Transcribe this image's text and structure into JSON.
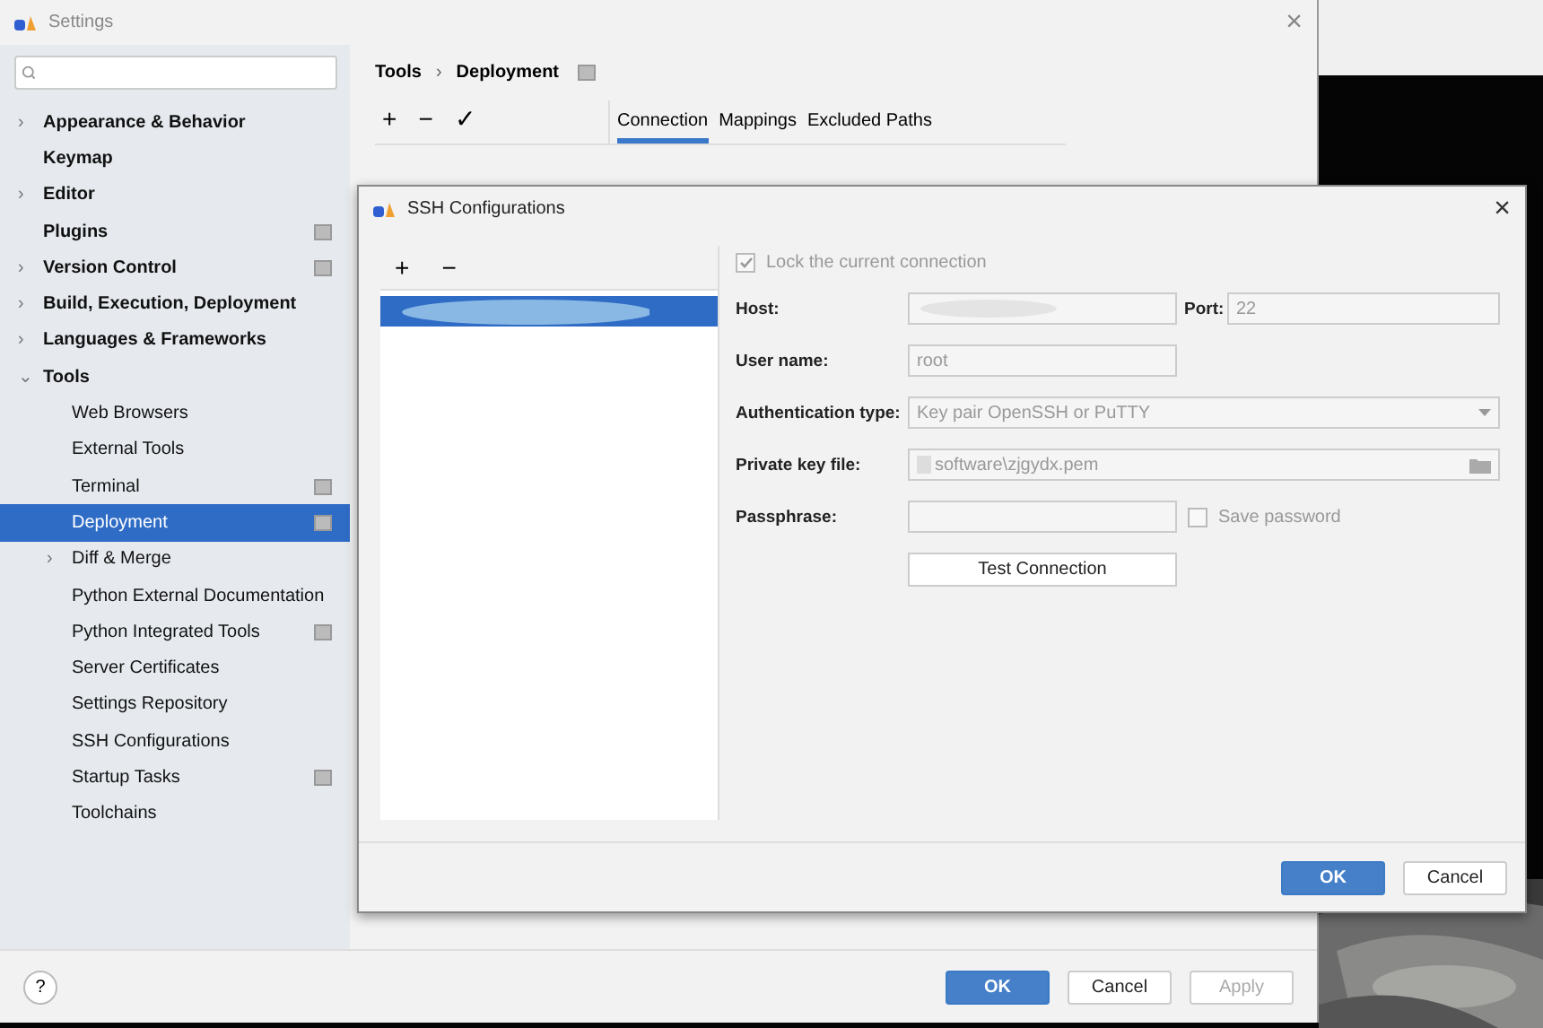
{
  "window": {
    "title": "Settings",
    "close": "×"
  },
  "sidebar": {
    "items": [
      {
        "label": "Appearance & Behavior",
        "toggle": "›",
        "badge": false,
        "selected": false
      },
      {
        "label": "Keymap",
        "badge": false,
        "selected": false
      },
      {
        "label": "Editor",
        "toggle": "›",
        "badge": false,
        "selected": false
      },
      {
        "label": "Plugins",
        "badge": true,
        "selected": false
      },
      {
        "label": "Version Control",
        "toggle": "›",
        "badge": true,
        "selected": false
      },
      {
        "label": "Build, Execution, Deployment",
        "toggle": "›",
        "badge": false,
        "selected": false
      },
      {
        "label": "Languages & Frameworks",
        "toggle": "›",
        "badge": false,
        "selected": false
      },
      {
        "label": "Tools",
        "toggle": "⌄",
        "badge": false,
        "selected": false,
        "children": [
          {
            "label": "Web Browsers",
            "badge": false,
            "selected": false
          },
          {
            "label": "External Tools",
            "badge": false,
            "selected": false
          },
          {
            "label": "Terminal",
            "badge": true,
            "selected": false
          },
          {
            "label": "Deployment",
            "badge": true,
            "selected": true
          },
          {
            "label": "Diff & Merge",
            "toggle": "›",
            "badge": false,
            "selected": false
          },
          {
            "label": "Python External Documentation",
            "badge": false,
            "selected": false
          },
          {
            "label": "Python Integrated Tools",
            "badge": true,
            "selected": false
          },
          {
            "label": "Server Certificates",
            "badge": false,
            "selected": false
          },
          {
            "label": "Settings Repository",
            "badge": false,
            "selected": false
          },
          {
            "label": "SSH Configurations",
            "badge": false,
            "selected": false
          },
          {
            "label": "Startup Tasks",
            "badge": true,
            "selected": false
          },
          {
            "label": "Toolchains",
            "badge": false,
            "selected": false
          }
        ]
      }
    ]
  },
  "breadcrumb": [
    "Tools",
    "›",
    "Deployment"
  ],
  "server_toolbar": [
    "+",
    "−",
    "✓"
  ],
  "tabs": [
    {
      "label": "Connection",
      "selected": true
    },
    {
      "label": "Mappings",
      "selected": false
    },
    {
      "label": "Excluded Paths",
      "selected": false
    }
  ],
  "footer": {
    "help": "?",
    "buttons": [
      {
        "label": "OK",
        "kind": "primary"
      },
      {
        "label": "Cancel",
        "kind": "normal"
      },
      {
        "label": "Apply",
        "kind": "disabled"
      }
    ]
  },
  "dialog": {
    "title": "SSH Configurations",
    "close": "×",
    "toolbar": [
      "+",
      "−"
    ],
    "configs": [
      {
        "selected": true
      }
    ],
    "lock": {
      "label": "Lock the current connection",
      "checked": true
    },
    "host_label": "Host:",
    "port_label": "Port:",
    "port": "22",
    "user_label": "User name:",
    "user": "root",
    "auth_label": "Authentication type:",
    "auth": "Key pair OpenSSH or PuTTY",
    "key_label": "Private key file:",
    "key": "software\\zjgydx.pem",
    "pass_label": "Passphrase:",
    "save_password": {
      "label": "Save password",
      "checked": false
    },
    "test": "Test Connection",
    "buttons": [
      {
        "label": "OK",
        "kind": "primary"
      },
      {
        "label": "Cancel",
        "kind": "normal"
      }
    ]
  }
}
